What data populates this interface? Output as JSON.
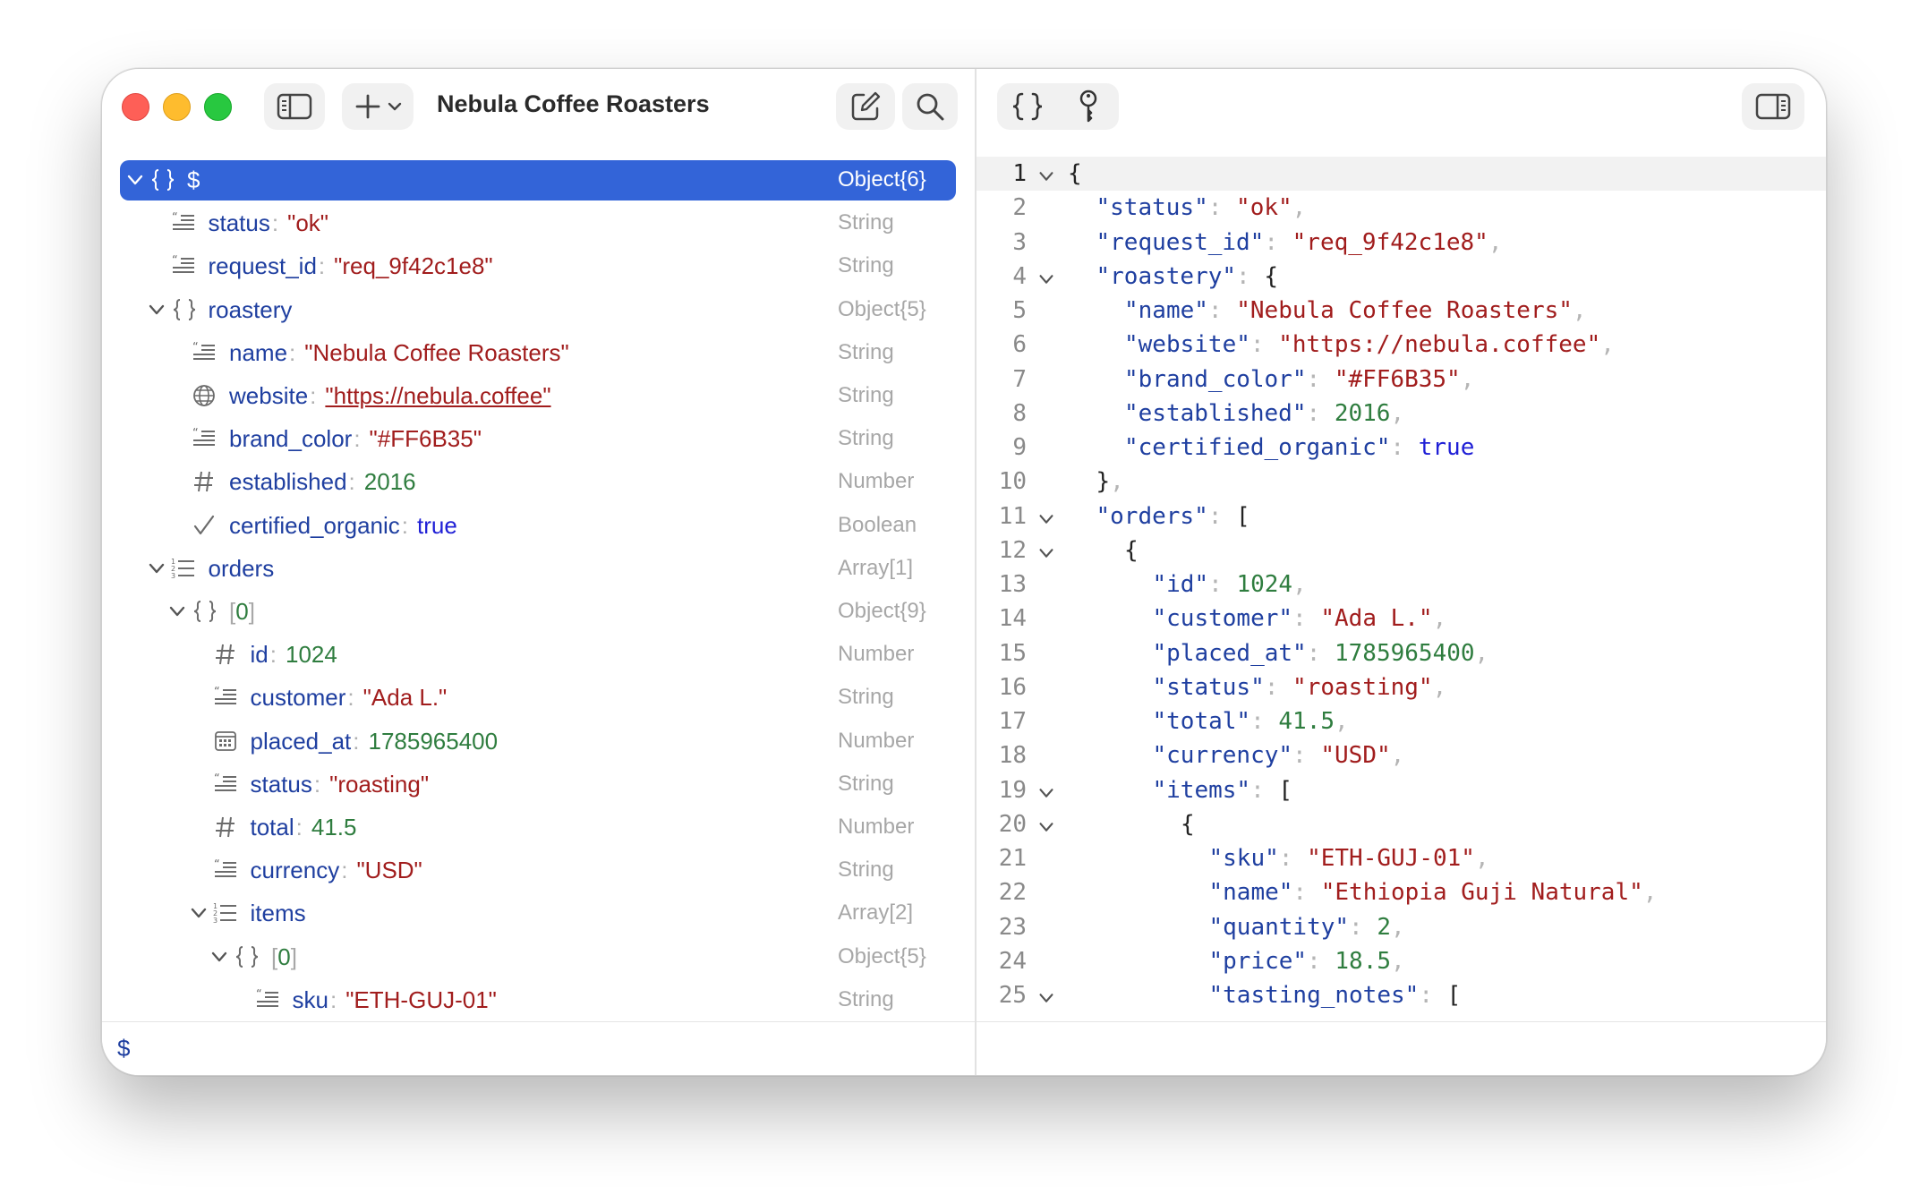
{
  "window": {
    "title": "Nebula Coffee Roasters",
    "path": "$"
  },
  "colors": {
    "selection": "#3364d8",
    "key": "#1f3fa0",
    "string": "#a11d1d",
    "number": "#2f7d3f",
    "boolean": "#1f1fd6"
  },
  "tree": [
    {
      "depth": 0,
      "expand": "down",
      "icon": "braces",
      "key": "$",
      "value": "",
      "vtype": "",
      "type": "Object{6}",
      "selected": true
    },
    {
      "depth": 1,
      "expand": "none",
      "icon": "quote",
      "key": "status",
      "value": "\"ok\"",
      "vtype": "str",
      "type": "String"
    },
    {
      "depth": 1,
      "expand": "none",
      "icon": "quote",
      "key": "request_id",
      "value": "\"req_9f42c1e8\"",
      "vtype": "str",
      "type": "String"
    },
    {
      "depth": 1,
      "expand": "down",
      "icon": "braces",
      "key": "roastery",
      "value": "",
      "vtype": "",
      "type": "Object{5}"
    },
    {
      "depth": 2,
      "expand": "none",
      "icon": "quote",
      "key": "name",
      "value": "\"Nebula Coffee Roasters\"",
      "vtype": "str",
      "type": "String"
    },
    {
      "depth": 2,
      "expand": "none",
      "icon": "globe",
      "key": "website",
      "value": "\"https://nebula.coffee\"",
      "vtype": "link",
      "type": "String"
    },
    {
      "depth": 2,
      "expand": "none",
      "icon": "quote",
      "key": "brand_color",
      "value": "\"#FF6B35\"",
      "vtype": "str",
      "type": "String"
    },
    {
      "depth": 2,
      "expand": "none",
      "icon": "hash",
      "key": "established",
      "value": "2016",
      "vtype": "num",
      "type": "Number"
    },
    {
      "depth": 2,
      "expand": "none",
      "icon": "check",
      "key": "certified_organic",
      "value": "true",
      "vtype": "bool",
      "type": "Boolean"
    },
    {
      "depth": 1,
      "expand": "down",
      "icon": "list",
      "key": "orders",
      "value": "",
      "vtype": "",
      "type": "Array[1]"
    },
    {
      "depth": 2,
      "expand": "down",
      "icon": "braces",
      "key": "",
      "index": "0",
      "value": "",
      "vtype": "",
      "type": "Object{9}"
    },
    {
      "depth": 3,
      "expand": "none",
      "icon": "hash",
      "key": "id",
      "value": "1024",
      "vtype": "num",
      "type": "Number"
    },
    {
      "depth": 3,
      "expand": "none",
      "icon": "quote",
      "key": "customer",
      "value": "\"Ada L.\"",
      "vtype": "str",
      "type": "String"
    },
    {
      "depth": 3,
      "expand": "none",
      "icon": "calendar",
      "key": "placed_at",
      "value": "1785965400",
      "vtype": "num",
      "type": "Number"
    },
    {
      "depth": 3,
      "expand": "none",
      "icon": "quote",
      "key": "status",
      "value": "\"roasting\"",
      "vtype": "str",
      "type": "String"
    },
    {
      "depth": 3,
      "expand": "none",
      "icon": "hash",
      "key": "total",
      "value": "41.5",
      "vtype": "num",
      "type": "Number"
    },
    {
      "depth": 3,
      "expand": "none",
      "icon": "quote",
      "key": "currency",
      "value": "\"USD\"",
      "vtype": "str",
      "type": "String"
    },
    {
      "depth": 3,
      "expand": "down",
      "icon": "list",
      "key": "items",
      "value": "",
      "vtype": "",
      "type": "Array[2]"
    },
    {
      "depth": 4,
      "expand": "down",
      "icon": "braces",
      "key": "",
      "index": "0",
      "value": "",
      "vtype": "",
      "type": "Object{5}"
    },
    {
      "depth": 5,
      "expand": "none",
      "icon": "quote",
      "key": "sku",
      "value": "\"ETH-GUJ-01\"",
      "vtype": "str",
      "type": "String"
    }
  ],
  "code": [
    {
      "n": "1",
      "fold": true,
      "indent": 0,
      "tokens": [
        [
          "p",
          "{"
        ]
      ]
    },
    {
      "n": "2",
      "fold": false,
      "indent": 1,
      "tokens": [
        [
          "k",
          "\"status\""
        ],
        [
          "u",
          ": "
        ],
        [
          "s",
          "\"ok\""
        ],
        [
          "u",
          ","
        ]
      ]
    },
    {
      "n": "3",
      "fold": false,
      "indent": 1,
      "tokens": [
        [
          "k",
          "\"request_id\""
        ],
        [
          "u",
          ": "
        ],
        [
          "s",
          "\"req_9f42c1e8\""
        ],
        [
          "u",
          ","
        ]
      ]
    },
    {
      "n": "4",
      "fold": true,
      "indent": 1,
      "tokens": [
        [
          "k",
          "\"roastery\""
        ],
        [
          "u",
          ": "
        ],
        [
          "p",
          "{"
        ]
      ]
    },
    {
      "n": "5",
      "fold": false,
      "indent": 2,
      "tokens": [
        [
          "k",
          "\"name\""
        ],
        [
          "u",
          ": "
        ],
        [
          "s",
          "\"Nebula Coffee Roasters\""
        ],
        [
          "u",
          ","
        ]
      ]
    },
    {
      "n": "6",
      "fold": false,
      "indent": 2,
      "tokens": [
        [
          "k",
          "\"website\""
        ],
        [
          "u",
          ": "
        ],
        [
          "s",
          "\"https://nebula.coffee\""
        ],
        [
          "u",
          ","
        ]
      ]
    },
    {
      "n": "7",
      "fold": false,
      "indent": 2,
      "tokens": [
        [
          "k",
          "\"brand_color\""
        ],
        [
          "u",
          ": "
        ],
        [
          "s",
          "\"#FF6B35\""
        ],
        [
          "u",
          ","
        ]
      ]
    },
    {
      "n": "8",
      "fold": false,
      "indent": 2,
      "tokens": [
        [
          "k",
          "\"established\""
        ],
        [
          "u",
          ": "
        ],
        [
          "n",
          "2016"
        ],
        [
          "u",
          ","
        ]
      ]
    },
    {
      "n": "9",
      "fold": false,
      "indent": 2,
      "tokens": [
        [
          "k",
          "\"certified_organic\""
        ],
        [
          "u",
          ": "
        ],
        [
          "b",
          "true"
        ]
      ]
    },
    {
      "n": "10",
      "fold": false,
      "indent": 1,
      "tokens": [
        [
          "p",
          "}"
        ],
        [
          "u",
          ","
        ]
      ]
    },
    {
      "n": "11",
      "fold": true,
      "indent": 1,
      "tokens": [
        [
          "k",
          "\"orders\""
        ],
        [
          "u",
          ": "
        ],
        [
          "p",
          "["
        ]
      ]
    },
    {
      "n": "12",
      "fold": true,
      "indent": 2,
      "tokens": [
        [
          "p",
          "{"
        ]
      ]
    },
    {
      "n": "13",
      "fold": false,
      "indent": 3,
      "tokens": [
        [
          "k",
          "\"id\""
        ],
        [
          "u",
          ": "
        ],
        [
          "n",
          "1024"
        ],
        [
          "u",
          ","
        ]
      ]
    },
    {
      "n": "14",
      "fold": false,
      "indent": 3,
      "tokens": [
        [
          "k",
          "\"customer\""
        ],
        [
          "u",
          ": "
        ],
        [
          "s",
          "\"Ada L.\""
        ],
        [
          "u",
          ","
        ]
      ]
    },
    {
      "n": "15",
      "fold": false,
      "indent": 3,
      "tokens": [
        [
          "k",
          "\"placed_at\""
        ],
        [
          "u",
          ": "
        ],
        [
          "n",
          "1785965400"
        ],
        [
          "u",
          ","
        ]
      ]
    },
    {
      "n": "16",
      "fold": false,
      "indent": 3,
      "tokens": [
        [
          "k",
          "\"status\""
        ],
        [
          "u",
          ": "
        ],
        [
          "s",
          "\"roasting\""
        ],
        [
          "u",
          ","
        ]
      ]
    },
    {
      "n": "17",
      "fold": false,
      "indent": 3,
      "tokens": [
        [
          "k",
          "\"total\""
        ],
        [
          "u",
          ": "
        ],
        [
          "n",
          "41.5"
        ],
        [
          "u",
          ","
        ]
      ]
    },
    {
      "n": "18",
      "fold": false,
      "indent": 3,
      "tokens": [
        [
          "k",
          "\"currency\""
        ],
        [
          "u",
          ": "
        ],
        [
          "s",
          "\"USD\""
        ],
        [
          "u",
          ","
        ]
      ]
    },
    {
      "n": "19",
      "fold": true,
      "indent": 3,
      "tokens": [
        [
          "k",
          "\"items\""
        ],
        [
          "u",
          ": "
        ],
        [
          "p",
          "["
        ]
      ]
    },
    {
      "n": "20",
      "fold": true,
      "indent": 4,
      "tokens": [
        [
          "p",
          "{"
        ]
      ]
    },
    {
      "n": "21",
      "fold": false,
      "indent": 5,
      "tokens": [
        [
          "k",
          "\"sku\""
        ],
        [
          "u",
          ": "
        ],
        [
          "s",
          "\"ETH-GUJ-01\""
        ],
        [
          "u",
          ","
        ]
      ]
    },
    {
      "n": "22",
      "fold": false,
      "indent": 5,
      "tokens": [
        [
          "k",
          "\"name\""
        ],
        [
          "u",
          ": "
        ],
        [
          "s",
          "\"Ethiopia Guji Natural\""
        ],
        [
          "u",
          ","
        ]
      ]
    },
    {
      "n": "23",
      "fold": false,
      "indent": 5,
      "tokens": [
        [
          "k",
          "\"quantity\""
        ],
        [
          "u",
          ": "
        ],
        [
          "n",
          "2"
        ],
        [
          "u",
          ","
        ]
      ]
    },
    {
      "n": "24",
      "fold": false,
      "indent": 5,
      "tokens": [
        [
          "k",
          "\"price\""
        ],
        [
          "u",
          ": "
        ],
        [
          "n",
          "18.5"
        ],
        [
          "u",
          ","
        ]
      ]
    },
    {
      "n": "25",
      "fold": true,
      "indent": 5,
      "tokens": [
        [
          "k",
          "\"tasting_notes\""
        ],
        [
          "u",
          ": "
        ],
        [
          "p",
          "["
        ]
      ]
    }
  ]
}
